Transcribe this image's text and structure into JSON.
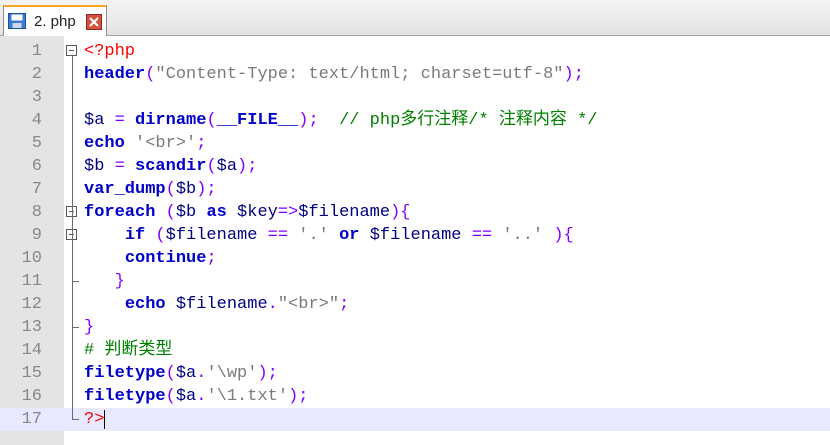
{
  "tab": {
    "label": "2. php",
    "save_icon": "save-icon",
    "close_icon": "close-icon"
  },
  "colors": {
    "keyword": "#0000cc",
    "string": "#7a7a7a",
    "variable": "#000080",
    "operator": "#8000ff",
    "comment": "#008000",
    "tag": "#ff0000"
  },
  "editor": {
    "current_line": 17,
    "lines": [
      {
        "n": "1",
        "fold": "open",
        "tokens": [
          {
            "t": "<?php",
            "c": "tag"
          }
        ]
      },
      {
        "n": "2",
        "fold": "",
        "tokens": [
          {
            "t": "header",
            "c": "kw"
          },
          {
            "t": "(",
            "c": "op"
          },
          {
            "t": "\"Content-Type: text/html; charset=utf-8\"",
            "c": "str"
          },
          {
            "t": ");",
            "c": "op"
          }
        ]
      },
      {
        "n": "3",
        "fold": "",
        "tokens": []
      },
      {
        "n": "4",
        "fold": "",
        "tokens": [
          {
            "t": "$a",
            "c": "var"
          },
          {
            "t": " = ",
            "c": "op"
          },
          {
            "t": "dirname",
            "c": "kw"
          },
          {
            "t": "(",
            "c": "op"
          },
          {
            "t": "__FILE__",
            "c": "kw"
          },
          {
            "t": ");",
            "c": "op"
          },
          {
            "t": "  ",
            "c": "txt"
          },
          {
            "t": "// php多行注释/* 注释内容 */",
            "c": "cm"
          }
        ]
      },
      {
        "n": "5",
        "fold": "",
        "tokens": [
          {
            "t": "echo",
            "c": "kw"
          },
          {
            "t": " ",
            "c": "txt"
          },
          {
            "t": "'<br>'",
            "c": "str"
          },
          {
            "t": ";",
            "c": "op"
          }
        ]
      },
      {
        "n": "6",
        "fold": "",
        "tokens": [
          {
            "t": "$b",
            "c": "var"
          },
          {
            "t": " = ",
            "c": "op"
          },
          {
            "t": "scandir",
            "c": "kw"
          },
          {
            "t": "(",
            "c": "op"
          },
          {
            "t": "$a",
            "c": "var"
          },
          {
            "t": ");",
            "c": "op"
          }
        ]
      },
      {
        "n": "7",
        "fold": "",
        "tokens": [
          {
            "t": "var_dump",
            "c": "kw"
          },
          {
            "t": "(",
            "c": "op"
          },
          {
            "t": "$b",
            "c": "var"
          },
          {
            "t": ");",
            "c": "op"
          }
        ]
      },
      {
        "n": "8",
        "fold": "open",
        "tokens": [
          {
            "t": "foreach",
            "c": "kw"
          },
          {
            "t": " (",
            "c": "op"
          },
          {
            "t": "$b",
            "c": "var"
          },
          {
            "t": " ",
            "c": "txt"
          },
          {
            "t": "as",
            "c": "kw"
          },
          {
            "t": " ",
            "c": "txt"
          },
          {
            "t": "$key",
            "c": "var"
          },
          {
            "t": "=>",
            "c": "op"
          },
          {
            "t": "$filename",
            "c": "var"
          },
          {
            "t": "){",
            "c": "op"
          }
        ]
      },
      {
        "n": "9",
        "fold": "open",
        "tokens": [
          {
            "t": "    ",
            "c": "txt"
          },
          {
            "t": "if",
            "c": "kw"
          },
          {
            "t": " (",
            "c": "op"
          },
          {
            "t": "$filename",
            "c": "var"
          },
          {
            "t": " == ",
            "c": "op"
          },
          {
            "t": "'.'",
            "c": "str"
          },
          {
            "t": " ",
            "c": "txt"
          },
          {
            "t": "or",
            "c": "kw"
          },
          {
            "t": " ",
            "c": "txt"
          },
          {
            "t": "$filename",
            "c": "var"
          },
          {
            "t": " == ",
            "c": "op"
          },
          {
            "t": "'..'",
            "c": "str"
          },
          {
            "t": " ){",
            "c": "op"
          }
        ]
      },
      {
        "n": "10",
        "fold": "",
        "tokens": [
          {
            "t": "    ",
            "c": "txt"
          },
          {
            "t": "continue",
            "c": "kw"
          },
          {
            "t": ";",
            "c": "op"
          }
        ]
      },
      {
        "n": "11",
        "fold": "end",
        "tokens": [
          {
            "t": "   ",
            "c": "txt"
          },
          {
            "t": "}",
            "c": "op"
          }
        ]
      },
      {
        "n": "12",
        "fold": "",
        "tokens": [
          {
            "t": "    ",
            "c": "txt"
          },
          {
            "t": "echo",
            "c": "kw"
          },
          {
            "t": " ",
            "c": "txt"
          },
          {
            "t": "$filename",
            "c": "var"
          },
          {
            "t": ".",
            "c": "op"
          },
          {
            "t": "\"<br>\"",
            "c": "str"
          },
          {
            "t": ";",
            "c": "op"
          }
        ]
      },
      {
        "n": "13",
        "fold": "end",
        "tokens": [
          {
            "t": "}",
            "c": "op"
          }
        ]
      },
      {
        "n": "14",
        "fold": "",
        "tokens": [
          {
            "t": "# 判断类型",
            "c": "cm"
          }
        ]
      },
      {
        "n": "15",
        "fold": "",
        "tokens": [
          {
            "t": "filetype",
            "c": "kw"
          },
          {
            "t": "(",
            "c": "op"
          },
          {
            "t": "$a",
            "c": "var"
          },
          {
            "t": ".",
            "c": "op"
          },
          {
            "t": "'\\wp'",
            "c": "str"
          },
          {
            "t": ");",
            "c": "op"
          }
        ]
      },
      {
        "n": "16",
        "fold": "",
        "tokens": [
          {
            "t": "filetype",
            "c": "kw"
          },
          {
            "t": "(",
            "c": "op"
          },
          {
            "t": "$a",
            "c": "var"
          },
          {
            "t": ".",
            "c": "op"
          },
          {
            "t": "'\\1.txt'",
            "c": "str"
          },
          {
            "t": ");",
            "c": "op"
          }
        ]
      },
      {
        "n": "17",
        "fold": "end",
        "tokens": [
          {
            "t": "?>",
            "c": "tag"
          }
        ]
      }
    ]
  }
}
